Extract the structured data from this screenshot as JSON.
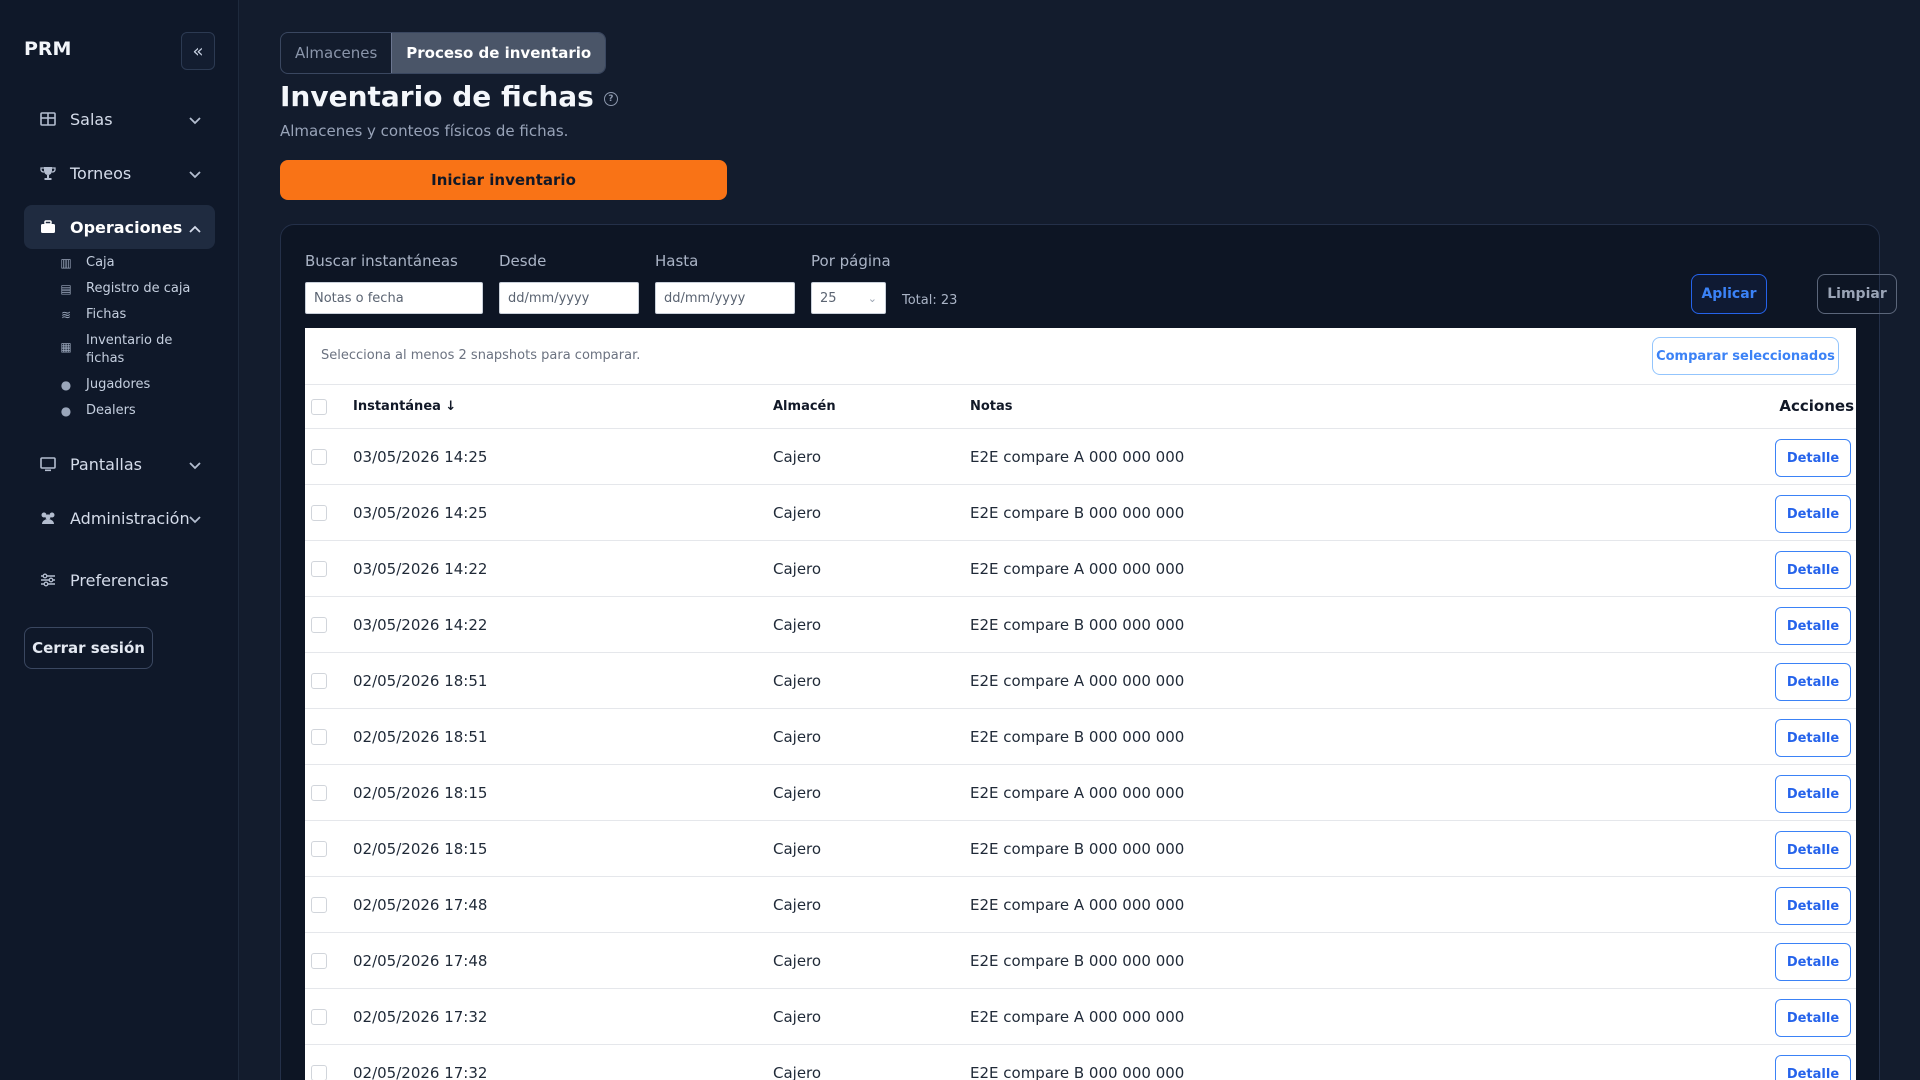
{
  "sidebar": {
    "brand": "PRM",
    "collapse_icon": "chevrons-left-icon",
    "items": [
      {
        "label": "Salas",
        "icon": "grid-icon"
      },
      {
        "label": "Torneos",
        "icon": "trophy-icon"
      },
      {
        "label": "Operaciones",
        "icon": "briefcase-icon"
      },
      {
        "label": "Pantallas",
        "icon": "monitor-icon"
      },
      {
        "label": "Administración",
        "icon": "users-icon"
      },
      {
        "label": "Preferencias",
        "icon": "sliders-icon"
      }
    ],
    "sub_items": [
      {
        "label": "Caja",
        "icon": "building-icon"
      },
      {
        "label": "Registro de caja",
        "icon": "book-icon"
      },
      {
        "label": "Fichas",
        "icon": "coins-icon"
      },
      {
        "label": "Inventario de fichas",
        "icon": "warehouse-icon"
      },
      {
        "label": "Jugadores",
        "icon": "user-icon"
      },
      {
        "label": "Dealers",
        "icon": "user-icon"
      }
    ],
    "logout_label": "Cerrar sesión"
  },
  "tabs": [
    {
      "label": "Almacenes",
      "active": false
    },
    {
      "label": "Proceso de inventario",
      "active": true
    }
  ],
  "page": {
    "title": "Inventario de fichas",
    "subtitle": "Almacenes y conteos físicos de fichas.",
    "start_button": "Iniciar inventario"
  },
  "filters": {
    "search_label": "Buscar instantáneas",
    "search_placeholder": "Notas o fecha",
    "from_label": "Desde",
    "from_placeholder": "dd/mm/yyyy",
    "to_label": "Hasta",
    "to_placeholder": "dd/mm/yyyy",
    "per_page_label": "Por página",
    "per_page_value": "25",
    "total": "Total: 23",
    "apply": "Aplicar",
    "clear": "Limpiar"
  },
  "compare": {
    "hint": "Selecciona al menos 2 snapshots para comparar.",
    "button": "Comparar seleccionados"
  },
  "table": {
    "headers": {
      "snapshot": "Instantánea ↓",
      "warehouse": "Almacén",
      "notes": "Notas",
      "actions": "Acciones"
    },
    "detail_label": "Detalle",
    "rows": [
      {
        "snapshot": "03/05/2026 14:25",
        "warehouse": "Cajero",
        "notes": "E2E compare A 000 000 000"
      },
      {
        "snapshot": "03/05/2026 14:25",
        "warehouse": "Cajero",
        "notes": "E2E compare B 000 000 000"
      },
      {
        "snapshot": "03/05/2026 14:22",
        "warehouse": "Cajero",
        "notes": "E2E compare A 000 000 000"
      },
      {
        "snapshot": "03/05/2026 14:22",
        "warehouse": "Cajero",
        "notes": "E2E compare B 000 000 000"
      },
      {
        "snapshot": "02/05/2026 18:51",
        "warehouse": "Cajero",
        "notes": "E2E compare A 000 000 000"
      },
      {
        "snapshot": "02/05/2026 18:51",
        "warehouse": "Cajero",
        "notes": "E2E compare B 000 000 000"
      },
      {
        "snapshot": "02/05/2026 18:15",
        "warehouse": "Cajero",
        "notes": "E2E compare A 000 000 000"
      },
      {
        "snapshot": "02/05/2026 18:15",
        "warehouse": "Cajero",
        "notes": "E2E compare B 000 000 000"
      },
      {
        "snapshot": "02/05/2026 17:48",
        "warehouse": "Cajero",
        "notes": "E2E compare A 000 000 000"
      },
      {
        "snapshot": "02/05/2026 17:48",
        "warehouse": "Cajero",
        "notes": "E2E compare B 000 000 000"
      },
      {
        "snapshot": "02/05/2026 17:32",
        "warehouse": "Cajero",
        "notes": "E2E compare A 000 000 000"
      },
      {
        "snapshot": "02/05/2026 17:32",
        "warehouse": "Cajero",
        "notes": "E2E compare B 000 000 000"
      }
    ]
  },
  "colors": {
    "accent": "#f97316",
    "primary": "#3b82f6",
    "sidebar_bg": "#0f1829",
    "page_bg": "#131c2d"
  }
}
